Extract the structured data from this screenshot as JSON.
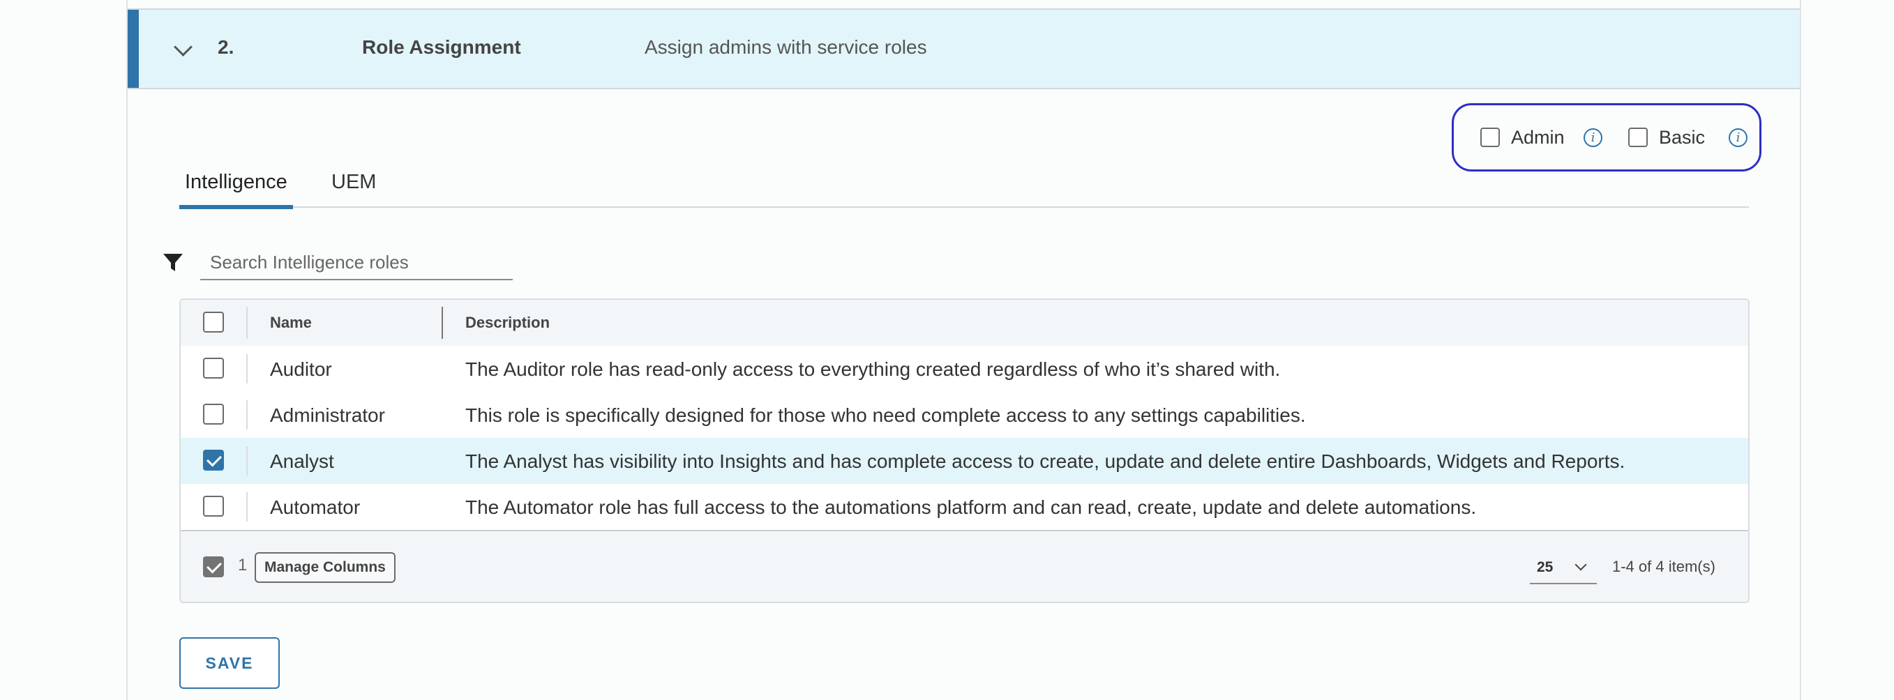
{
  "step": {
    "number": "2.",
    "title": "Role Assignment",
    "subtitle": "Assign admins with service roles"
  },
  "role_types": [
    {
      "label": "Admin",
      "checked": false,
      "info_icon": "info-icon"
    },
    {
      "label": "Basic",
      "checked": false,
      "info_icon": "info-icon"
    }
  ],
  "tabs": [
    {
      "label": "Intelligence",
      "active": true
    },
    {
      "label": "UEM",
      "active": false
    }
  ],
  "search": {
    "placeholder": "Search Intelligence roles",
    "value": "",
    "icon": "filter-icon"
  },
  "table": {
    "columns": [
      "Name",
      "Description"
    ],
    "rows": [
      {
        "name": "Auditor",
        "description": "The Auditor role has read-only access to everything created regardless of who it’s shared with.",
        "checked": false
      },
      {
        "name": "Administrator",
        "description": "This role is specifically designed for those who need complete access to any settings capabilities.",
        "checked": false
      },
      {
        "name": "Analyst",
        "description": "The Analyst has visibility into Insights and has complete access to create, update and delete entire Dashboards, Widgets and Reports.",
        "checked": true
      },
      {
        "name": "Automator",
        "description": "The Automator role has full access to the automations platform and can read, create, update and delete automations.",
        "checked": false
      }
    ],
    "footer": {
      "selected_count": "1",
      "manage_columns_label": "Manage Columns",
      "page_size": "25",
      "pagination": "1-4 of 4 item(s)"
    }
  },
  "actions": {
    "save_label": "SAVE"
  },
  "colors": {
    "accent": "#2f74a8",
    "header_bg": "#e2f5fb",
    "highlight_box": "#2b2fc4"
  }
}
